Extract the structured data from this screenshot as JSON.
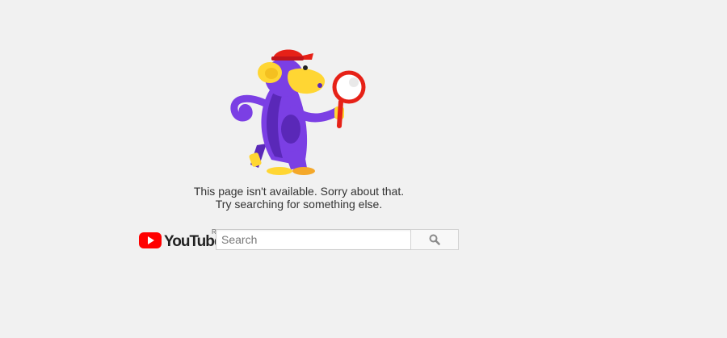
{
  "error": {
    "line1": "This page isn't available. Sorry about that.",
    "line2": "Try searching for something else."
  },
  "logo": {
    "name": "youtube-logo",
    "text": "YouTube",
    "region_marker": "R"
  },
  "search": {
    "placeholder": "Search",
    "value": "",
    "button_icon": "search-icon"
  },
  "illustration": {
    "name": "monkey-with-magnifying-glass"
  },
  "colors": {
    "background": "#f1f1f1",
    "brand_red": "#ff0000",
    "monkey_purple": "#7b3fe4",
    "monkey_yellow": "#ffd633",
    "hat_red": "#e62117"
  }
}
